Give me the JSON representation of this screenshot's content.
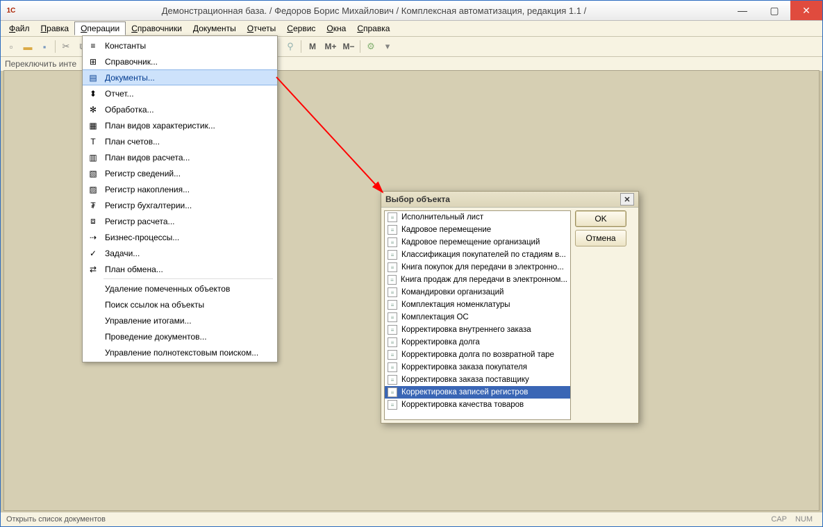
{
  "titlebar": {
    "logo": "1C",
    "title": "Демонстрационная база. / Федоров Борис Михайлович / Комплексная автоматизация, редакция 1.1 /"
  },
  "menubar": [
    "Файл",
    "Правка",
    "Операции",
    "Справочники",
    "Документы",
    "Отчеты",
    "Сервис",
    "Окна",
    "Справка"
  ],
  "menubar_active_index": 2,
  "hint": "Переключить инте",
  "dropdown": {
    "highlight_index": 2,
    "items_top": [
      {
        "icon": "≡",
        "label": "Константы"
      },
      {
        "icon": "⊞",
        "label": "Справочник..."
      },
      {
        "icon": "▤",
        "label": "Документы..."
      },
      {
        "icon": "⬍",
        "label": "Отчет..."
      },
      {
        "icon": "✻",
        "label": "Обработка..."
      },
      {
        "icon": "▦",
        "label": "План видов характеристик..."
      },
      {
        "icon": "T",
        "label": "План счетов..."
      },
      {
        "icon": "▥",
        "label": "План видов расчета..."
      },
      {
        "icon": "▧",
        "label": "Регистр сведений..."
      },
      {
        "icon": "▨",
        "label": "Регистр накопления..."
      },
      {
        "icon": "₮",
        "label": "Регистр бухгалтерии..."
      },
      {
        "icon": "⧈",
        "label": "Регистр расчета..."
      },
      {
        "icon": "⇢",
        "label": "Бизнес-процессы..."
      },
      {
        "icon": "✓",
        "label": "Задачи..."
      },
      {
        "icon": "⇄",
        "label": "План обмена..."
      }
    ],
    "items_bottom": [
      "Удаление помеченных объектов",
      "Поиск ссылок на объекты",
      "Управление итогами...",
      "Проведение документов...",
      "Управление полнотекстовым поиском..."
    ]
  },
  "dialog": {
    "title": "Выбор объекта",
    "ok": "OK",
    "cancel": "Отмена",
    "selected_index": 15,
    "items": [
      "Исполнительный лист",
      "Кадровое перемещение",
      "Кадровое перемещение организаций",
      "Классификация покупателей по стадиям в...",
      "Книга покупок для передачи в электронно...",
      "Книга продаж для передачи в электронном...",
      "Командировки организаций",
      "Комплектация номенклатуры",
      "Комплектация ОС",
      "Корректировка внутреннего заказа",
      "Корректировка долга",
      "Корректировка долга по возвратной таре",
      "Корректировка заказа покупателя",
      "Корректировка заказа поставщику",
      "Корректировка записей регистров",
      "Корректировка качества товаров"
    ]
  },
  "status": {
    "text": "Открыть список документов",
    "cap": "CAP",
    "num": "NUM"
  },
  "toolbar_text": {
    "m": "M",
    "mplus": "M+",
    "mminus": "M−"
  }
}
